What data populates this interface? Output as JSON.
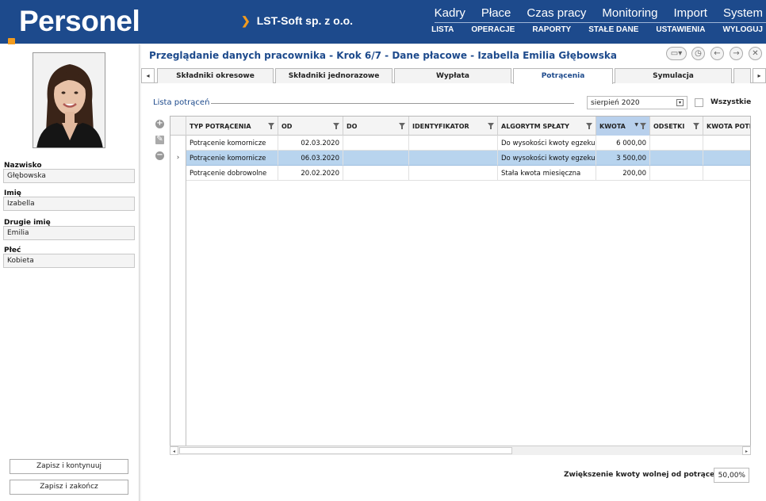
{
  "header": {
    "logo": "Personel",
    "company": "LST-Soft  sp. z o.o.",
    "main_menu": [
      "Kadry",
      "Płace",
      "Czas pracy",
      "Monitoring",
      "Import",
      "System"
    ],
    "sub_menu": [
      "LISTA",
      "OPERACJE",
      "RAPORTY",
      "STAŁE DANE",
      "USTAWIENIA",
      "WYLOGUJ"
    ]
  },
  "employee": {
    "surname_label": "Nazwisko",
    "surname": "Głębowska",
    "first_name_label": "Imię",
    "first_name": "Izabella",
    "second_name_label": "Drugie imię",
    "second_name": "Emilia",
    "gender_label": "Płeć",
    "gender": "Kobieta"
  },
  "buttons": {
    "save_continue": "Zapisz i kontynuuj",
    "save_finish": "Zapisz i zakończ"
  },
  "page": {
    "title": "Przeglądanie danych pracownika - Krok 6/7 - Dane płacowe - Izabella Emilia Głębowska"
  },
  "tabs": [
    "Składniki okresowe",
    "Składniki jednorazowe",
    "Wypłata",
    "Potrącenia",
    "Symulacja"
  ],
  "active_tab": "Potrącenia",
  "list": {
    "label": "Lista potrąceń",
    "date": "sierpień 2020",
    "all_label": "Wszystkie"
  },
  "grid": {
    "columns": [
      "TYP POTRĄCENIA",
      "OD",
      "DO",
      "IDENTYFIKATOR",
      "ALGORYTM SPŁATY",
      "KWOTA",
      "ODSETKI",
      "KWOTA POTRĄ"
    ],
    "sorted_column": "KWOTA",
    "rows": [
      {
        "typ": "Potrącenie komornicze",
        "od": "02.03.2020",
        "do": "",
        "id": "",
        "alg": "Do wysokości kwoty egzekucji",
        "kwota": "6 000,00",
        "odsetki": "",
        "kp": ""
      },
      {
        "typ": "Potrącenie komornicze",
        "od": "06.03.2020",
        "do": "",
        "id": "",
        "alg": "Do wysokości kwoty egzekucji",
        "kwota": "3 500,00",
        "odsetki": "",
        "kp": ""
      },
      {
        "typ": "Potrącenie dobrowolne",
        "od": "20.02.2020",
        "do": "",
        "id": "",
        "alg": "Stała kwota miesięczna",
        "kwota": "200,00",
        "odsetki": "",
        "kp": ""
      }
    ],
    "selected_row": 1
  },
  "footer": {
    "label": "Zwiększenie kwoty wolnej od potrąceń",
    "value": "50,00%"
  },
  "colors": {
    "header_bg": "#1d4a8c",
    "accent": "#f29b1e",
    "selected_row": "#b8d4ee"
  }
}
